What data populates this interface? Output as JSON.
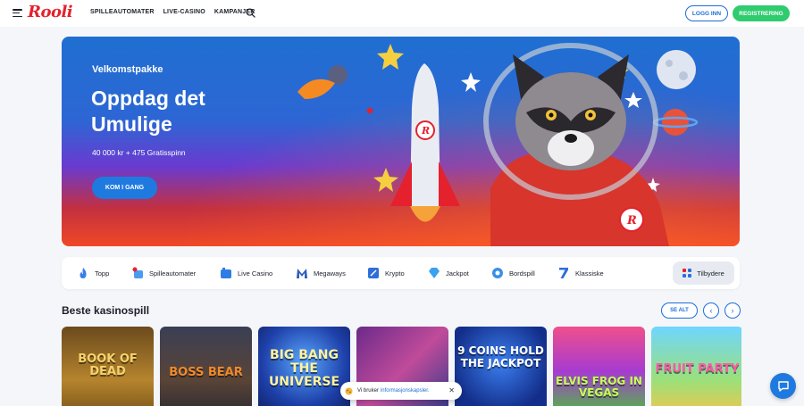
{
  "brand": {
    "logo": "Rooli",
    "accent": "#e4212d",
    "primary": "#1f7ae0",
    "success": "#2ecc6f"
  },
  "header": {
    "nav": [
      "SPILLEAUTOMATER",
      "LIVE-CASINO",
      "KAMPANJER"
    ],
    "login_label": "LOGG INN",
    "register_label": "REGISTRERING"
  },
  "hero": {
    "eyebrow": "Velkomstpakke",
    "title": "Oppdag det Umulige",
    "subtitle": "40 000 kr + 475 Gratisspinn",
    "cta_label": "KOM I GANG"
  },
  "categories": [
    {
      "label": "Topp",
      "icon": "flame-icon"
    },
    {
      "label": "Spilleautomater",
      "icon": "slot-icon"
    },
    {
      "label": "Live Casino",
      "icon": "live-icon"
    },
    {
      "label": "Megaways",
      "icon": "megaways-icon"
    },
    {
      "label": "Krypto",
      "icon": "crypto-icon"
    },
    {
      "label": "Jackpot",
      "icon": "diamond-icon"
    },
    {
      "label": "Bordspill",
      "icon": "table-games-icon"
    },
    {
      "label": "Klassiske",
      "icon": "seven-icon"
    }
  ],
  "providers_label": "Tilbydere",
  "games_section": {
    "title": "Beste kasinospill",
    "see_all_label": "SE ALT",
    "games": [
      {
        "title": "BOOK OF DEAD"
      },
      {
        "title": "BOSS BEAR"
      },
      {
        "title": "BIG BANG THE UNIVERSE"
      },
      {
        "title": ""
      },
      {
        "title": "9 COINS HOLD THE JACKPOT"
      },
      {
        "title": "ELVIS FROG IN VEGAS"
      },
      {
        "title": "FRUIT PARTY"
      }
    ]
  },
  "cookie": {
    "text": "Vi bruker",
    "link": "informasjonskapsler."
  }
}
